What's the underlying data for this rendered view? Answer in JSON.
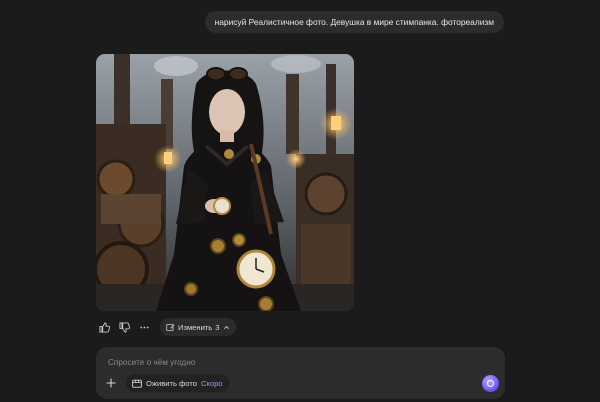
{
  "chat": {
    "user_message": "нарисуй Реалистичное фото. Девушка в мире стимпанка. фотореализм",
    "image_alt": "Девушка в мире стимпанка"
  },
  "actions": {
    "like_icon": "thumbs-up-icon",
    "dislike_icon": "thumbs-down-icon",
    "more_icon": "more-dots-icon",
    "edit_label": "Изменить",
    "edit_count": "3"
  },
  "composer": {
    "placeholder": "Спросите о чём угодно",
    "animate_label": "Оживить фото",
    "soon_badge": "Скоро"
  },
  "colors": {
    "background": "#1b1b1b",
    "bubble": "#2c2c2c",
    "accent": "#7b5cf5"
  }
}
